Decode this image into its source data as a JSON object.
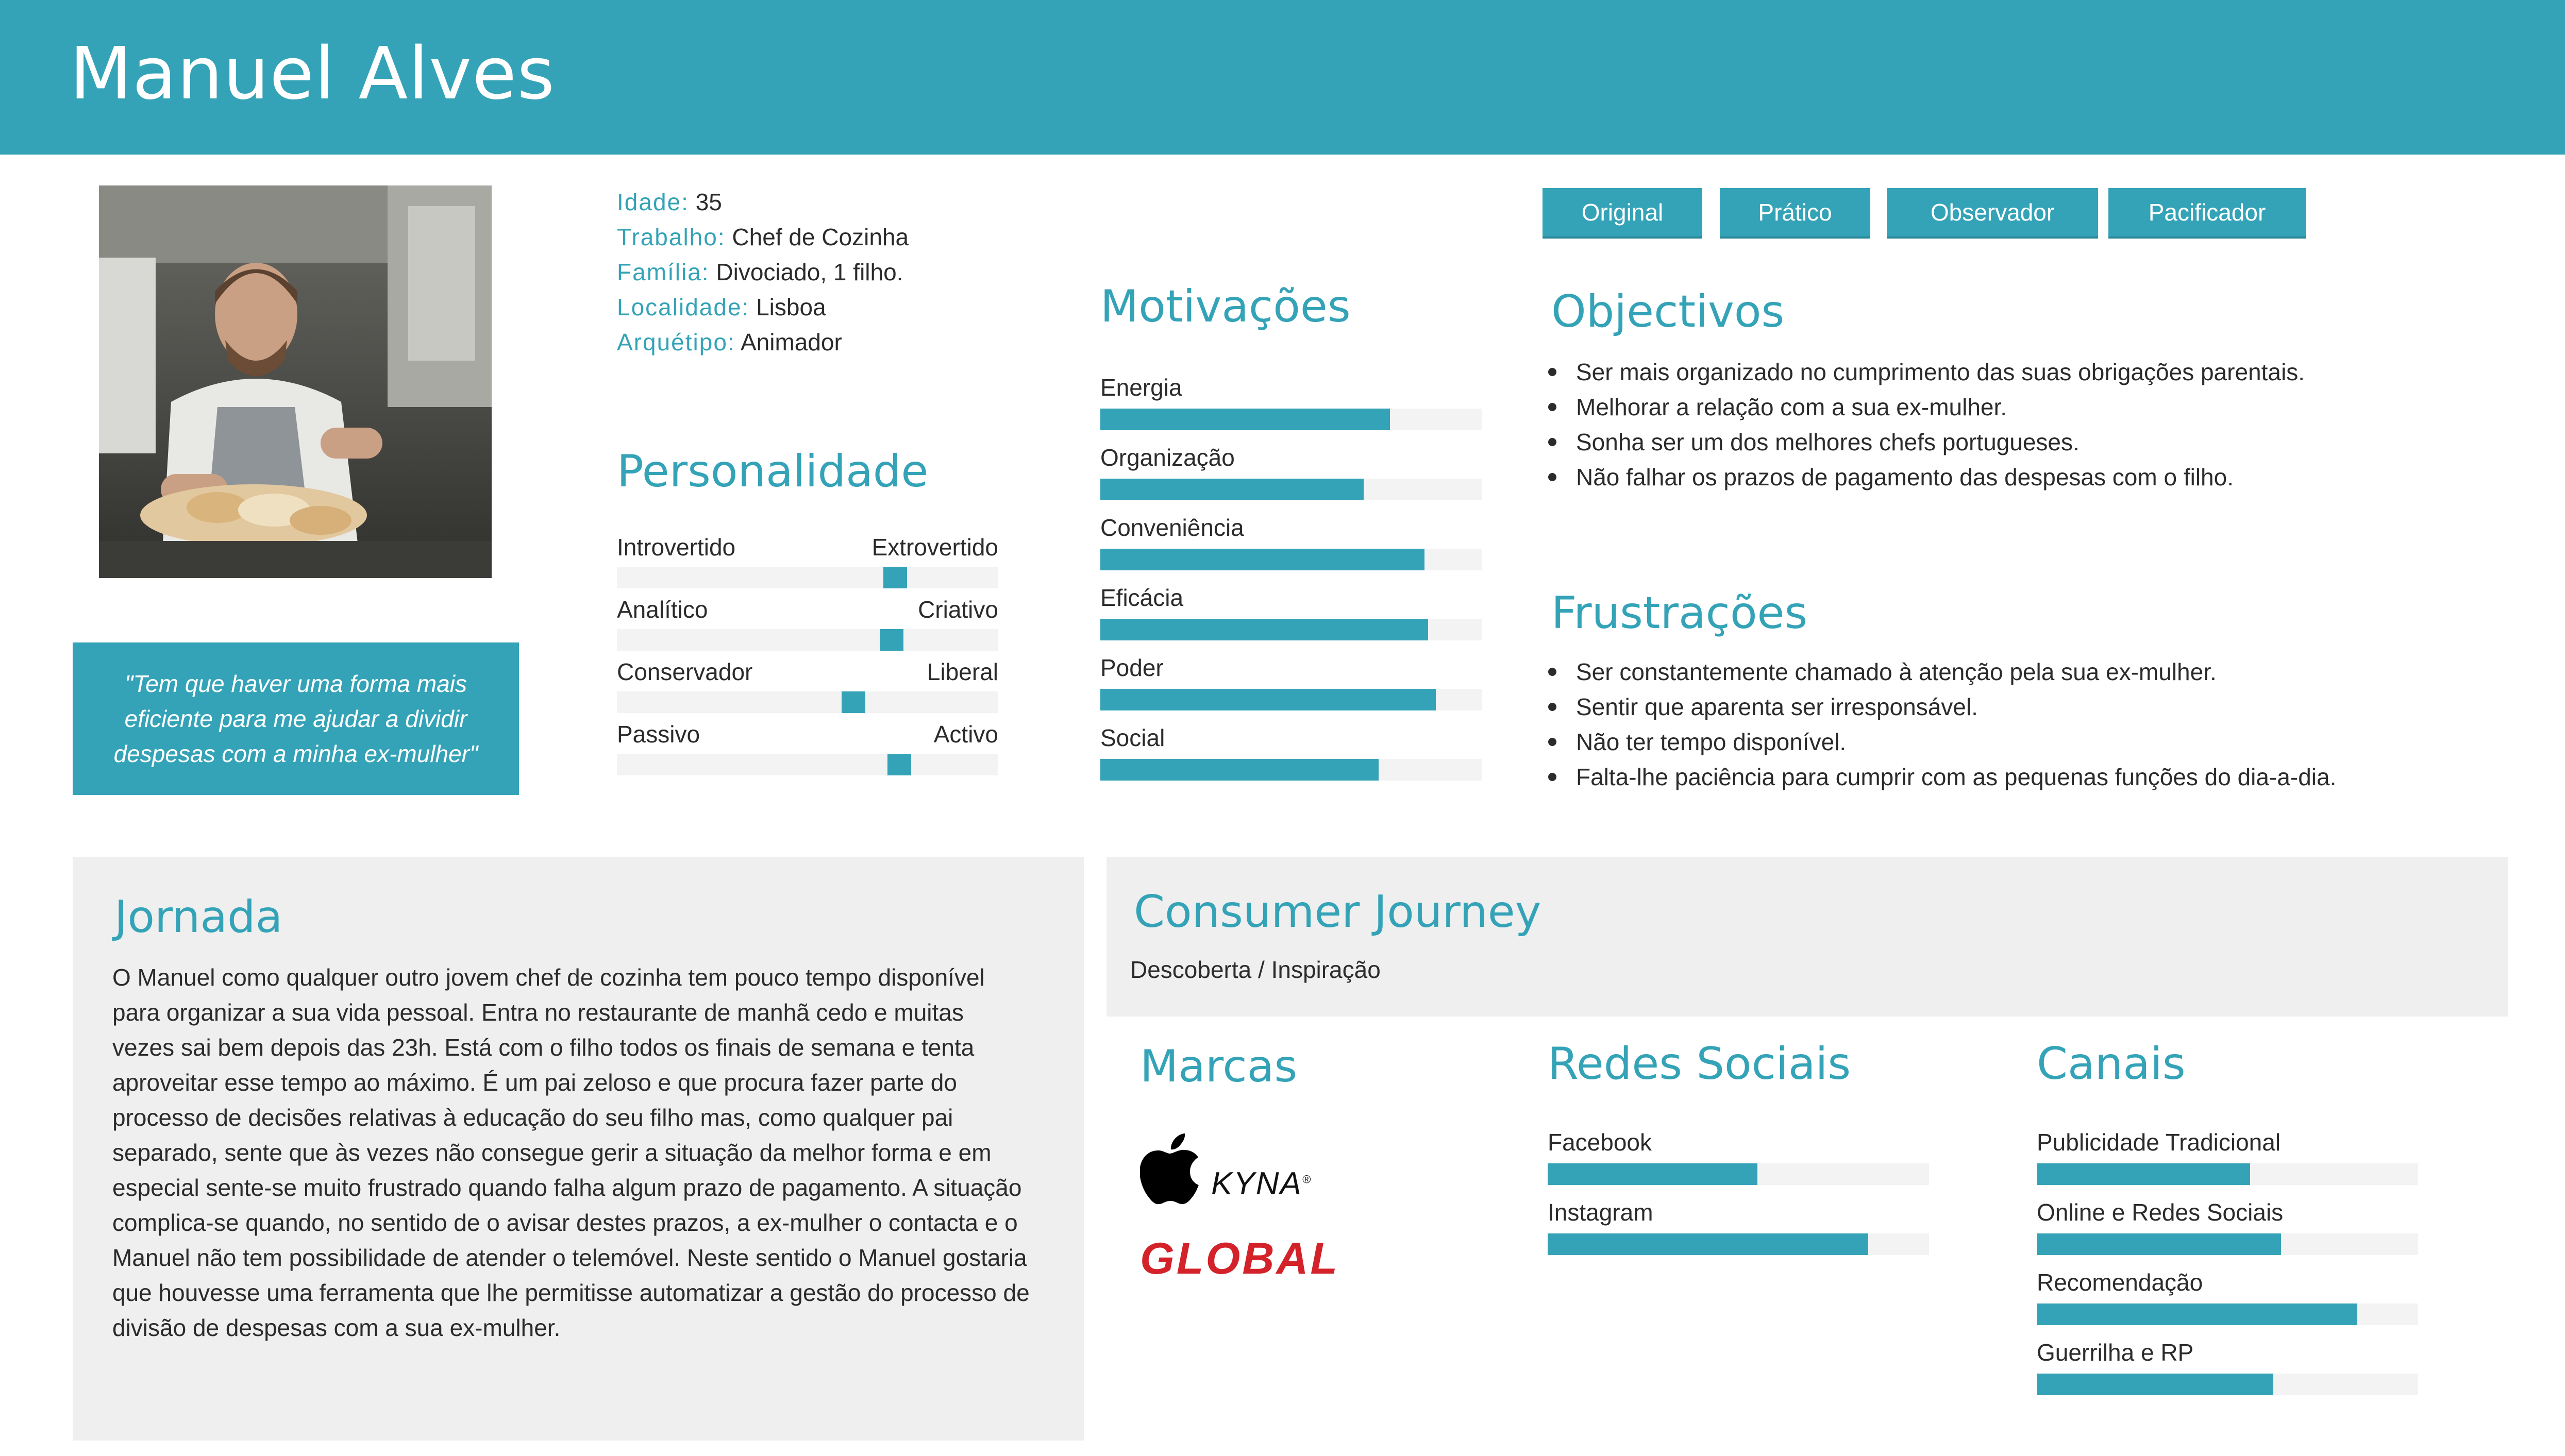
{
  "header": {
    "name": "Manuel Alves"
  },
  "quote": "\"Tem que haver uma forma mais eficiente para me ajudar a dividir despesas com a minha ex-mulher\"",
  "bio": [
    {
      "label": "Idade:",
      "value": "35"
    },
    {
      "label": "Trabalho:",
      "value": "Chef de Cozinha"
    },
    {
      "label": "Família:",
      "value": "Divociado, 1 filho."
    },
    {
      "label": "Localidade:",
      "value": "Lisboa"
    },
    {
      "label": "Arquétipo:",
      "value": "Animador"
    }
  ],
  "personality": {
    "title": "Personalidade",
    "sliders": [
      {
        "left": "Introvertido",
        "right": "Extrovertido",
        "value": 0.73
      },
      {
        "left": "Analítico",
        "right": "Criativo",
        "value": 0.72
      },
      {
        "left": "Conservador",
        "right": "Liberal",
        "value": 0.62
      },
      {
        "left": "Passivo",
        "right": "Activo",
        "value": 0.74
      }
    ]
  },
  "motivations": {
    "title": "Motivações",
    "items": [
      {
        "label": "Energia",
        "value": 0.76
      },
      {
        "label": "Organização",
        "value": 0.69
      },
      {
        "label": "Conveniência",
        "value": 0.85
      },
      {
        "label": "Eficácia",
        "value": 0.86
      },
      {
        "label": "Poder",
        "value": 0.88
      },
      {
        "label": "Social",
        "value": 0.73
      }
    ]
  },
  "tags": [
    "Original",
    "Prático",
    "Observador",
    "Pacificador"
  ],
  "objectives": {
    "title": "Objectivos",
    "items": [
      "Ser mais organizado no cumprimento das suas obrigações parentais.",
      "Melhorar a relação com a sua ex-mulher.",
      "Sonha ser um dos melhores chefs portugueses.",
      "Não falhar os prazos de pagamento das despesas com o filho."
    ]
  },
  "frustrations": {
    "title": "Frustrações",
    "items": [
      "Ser constantemente chamado à atenção pela sua ex-mulher.",
      "Sentir que aparenta ser irresponsável.",
      "Não ter tempo disponível.",
      "Falta-lhe paciência para cumprir com as pequenas funções do dia-a-dia."
    ]
  },
  "journey": {
    "title": "Jornada",
    "text": "O Manuel como qualquer outro jovem chef de cozinha tem pouco tempo disponível para organizar a sua vida pessoal. Entra no restaurante de manhã cedo e muitas vezes sai bem depois das 23h. Está com o filho todos os finais de semana e tenta aproveitar esse tempo ao máximo. É um pai zeloso e que procura fazer parte do processo de decisões relativas à educação do seu filho mas, como qualquer pai separado, sente que às vezes não consegue gerir a situação da melhor forma e em especial sente-se muito frustrado quando falha algum prazo de pagamento. A situação complica-se quando, no sentido de o avisar destes prazos, a ex-mulher o contacta e o Manuel não tem possibilidade de atender o telemóvel. Neste sentido o Manuel gostaria que houvesse uma ferramenta que lhe permitisse automatizar a gestão do processo de divisão de despesas com a sua ex-mulher."
  },
  "consumer_journey": {
    "title": "Consumer Journey",
    "subtitle": "Descoberta / Inspiração"
  },
  "brands": {
    "title": "Marcas",
    "logos": {
      "apple": "apple-logo",
      "kyna": "KYNA",
      "kyna_mark": "®",
      "global": "GLOBAL"
    }
  },
  "social": {
    "title": "Redes Sociais",
    "items": [
      {
        "label": "Facebook",
        "value": 0.55
      },
      {
        "label": "Instagram",
        "value": 0.84
      }
    ]
  },
  "channels": {
    "title": "Canais",
    "items": [
      {
        "label": "Publicidade Tradicional",
        "value": 0.56
      },
      {
        "label": "Online e Redes Sociais",
        "value": 0.64
      },
      {
        "label": "Recomendação",
        "value": 0.84
      },
      {
        "label": "Guerrilha e RP",
        "value": 0.62
      }
    ]
  },
  "colors": {
    "accent": "#34a3b7",
    "track": "#f3f3f3",
    "panel": "#efefef",
    "global_red": "#d3222a"
  }
}
